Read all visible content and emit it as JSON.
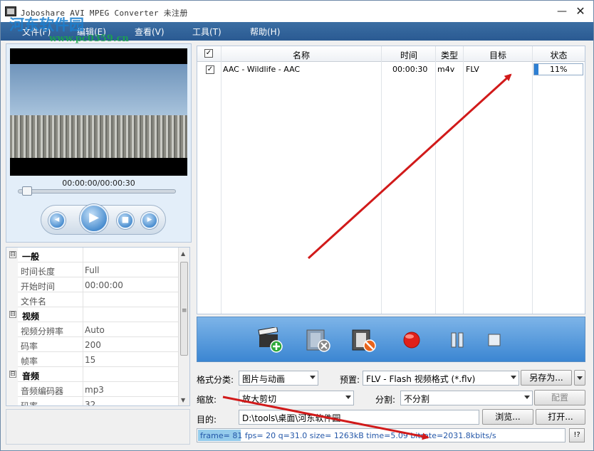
{
  "window": {
    "title": "Joboshare AVI MPEG Converter 未注册",
    "watermark_logo": "河东软件园",
    "watermark_url": "www.pc0359.cn"
  },
  "menu": [
    "文件(F)",
    "编辑(E)",
    "查看(V)",
    "工具(T)",
    "帮助(H)"
  ],
  "player": {
    "timecode": "00:00:00/00:00:30",
    "seek_progress": 0.02
  },
  "properties": [
    {
      "type": "category",
      "label": "一般",
      "toggle": "⊟"
    },
    {
      "type": "row",
      "key": "时间长度",
      "value": "Full"
    },
    {
      "type": "row",
      "key": "开始时间",
      "value": "00:00:00"
    },
    {
      "type": "row",
      "key": "文件名",
      "value": ""
    },
    {
      "type": "category",
      "label": "视频",
      "toggle": "⊟"
    },
    {
      "type": "row",
      "key": "视频分辨率",
      "value": "Auto"
    },
    {
      "type": "row",
      "key": "码率",
      "value": "200"
    },
    {
      "type": "row",
      "key": "帧率",
      "value": "15"
    },
    {
      "type": "category",
      "label": "音频",
      "toggle": "⊟"
    },
    {
      "type": "row",
      "key": "音频编码器",
      "value": "mp3"
    },
    {
      "type": "row",
      "key": "码率",
      "value": "32"
    }
  ],
  "file_list": {
    "columns": [
      "名称",
      "时间",
      "类型",
      "目标",
      "状态"
    ],
    "rows": [
      {
        "checked": true,
        "name": "AAC - Wildlife - AAC",
        "time": "00:00:30",
        "type": "m4v",
        "target": "FLV",
        "status": "11%",
        "progress": 0.11
      }
    ]
  },
  "toolbar": [
    "add-video-icon",
    "remove-video-icon",
    "clear-list-icon",
    "record-icon",
    "pause-icon",
    "stop-icon"
  ],
  "options": {
    "format_label": "格式分类:",
    "format_value": "图片与动画",
    "preset_label": "预置:",
    "preset_value": "FLV - Flash 视频格式 (*.flv)",
    "save_as": "另存为...",
    "zoom_label": "缩放:",
    "zoom_value": "放大剪切",
    "split_label": "分割:",
    "split_value": "不分割",
    "config": "配置",
    "dest_label": "目的:",
    "dest_value": "D:\\tools\\桌面\\河东软件园",
    "browse": "浏览...",
    "open": "打开..."
  },
  "status": {
    "text": "frame= 81 fps= 20 q=31.0 size= 1263kB time=5.09 bitrate=2031.8kbits/s",
    "help": "!?"
  },
  "colors": {
    "menubar": "#2f6399",
    "toolbar": "#3b86d2",
    "annotation_arrow": "#d11a1a"
  }
}
